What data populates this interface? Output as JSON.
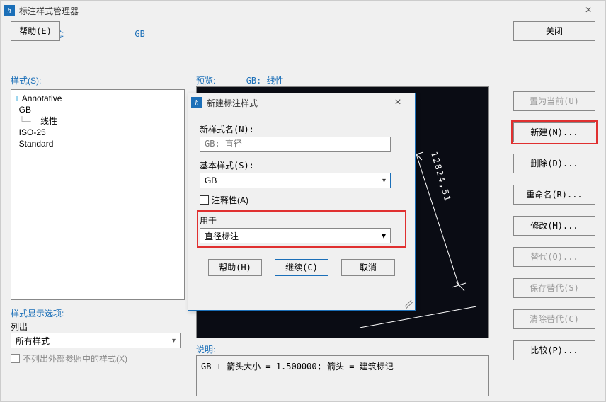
{
  "window": {
    "title": "标注样式管理器",
    "close_glyph": "×",
    "icon_glyph": "h"
  },
  "current": {
    "label": "当前标注样式:",
    "value": "GB"
  },
  "styles": {
    "label": "样式(S):",
    "items": [
      "Annotative",
      "GB",
      "   线性",
      "ISO-25",
      "Standard"
    ],
    "annot_glyph": "⟂"
  },
  "display_filter": {
    "label": "样式显示选项:",
    "sub_label": "列出",
    "combo_value": "所有样式",
    "checkbox_label": "不列出外部参照中的样式(X)"
  },
  "preview": {
    "label": "预览:",
    "style_text": "GB: 线性",
    "dim_value": "12824,51"
  },
  "description": {
    "label": "说明:",
    "text": "GB + 箭头大小  = 1.500000; 箭头 = 建筑标记"
  },
  "buttons": {
    "set_current": "置为当前(U)",
    "new": "新建(N)...",
    "delete": "删除(D)...",
    "rename": "重命名(R)...",
    "modify": "修改(M)...",
    "override": "替代(O)...",
    "save_override": "保存替代(S)",
    "clear_override": "清除替代(C)",
    "compare": "比较(P)...",
    "help": "帮助(E)",
    "close": "关闭"
  },
  "modal": {
    "title": "新建标注样式",
    "icon_glyph": "h",
    "close_glyph": "×",
    "new_name_label": "新样式名(N):",
    "new_name_value": "GB: 直径",
    "base_label": "基本样式(S):",
    "base_value": "GB",
    "annot_label": "注释性(A)",
    "used_for_label": "用于",
    "used_for_value": "直径标注",
    "help": "帮助(H)",
    "continue": "继续(C)",
    "cancel": "取消"
  }
}
